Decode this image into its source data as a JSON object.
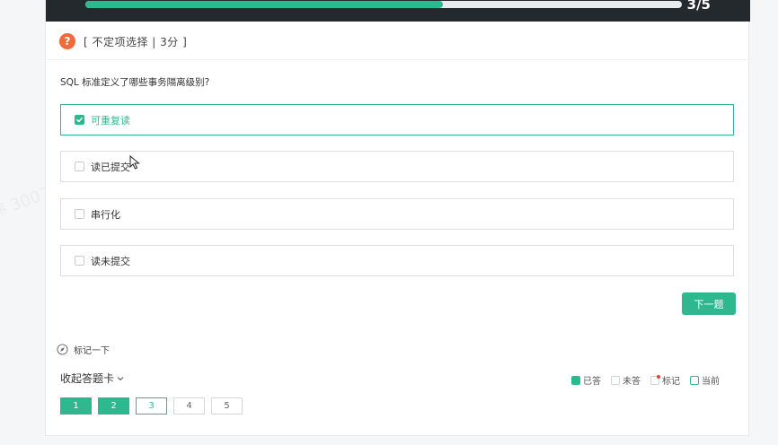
{
  "progress": {
    "text": "3/5",
    "fraction": 0.6
  },
  "question": {
    "type_label": "[ 不定项选择 | 3分 ]",
    "icon_glyph": "?",
    "text": "SQL 标准定义了哪些事务隔离级别?"
  },
  "options": [
    {
      "label": "可重复读",
      "checked": true
    },
    {
      "label": "读已提交",
      "checked": false
    },
    {
      "label": "串行化",
      "checked": false
    },
    {
      "label": "读未提交",
      "checked": false
    }
  ],
  "next_button": {
    "label": "下一题"
  },
  "mark": {
    "label": "标记一下",
    "icon": "compass-icon"
  },
  "answer_card": {
    "collapse_label": "收起答题卡",
    "legend": {
      "answered": "已答",
      "unanswered": "未答",
      "marked": "标记",
      "current": "当前"
    },
    "numbers": [
      {
        "label": "1",
        "state": "answered"
      },
      {
        "label": "2",
        "state": "answered"
      },
      {
        "label": "3",
        "state": "current"
      },
      {
        "label": "4",
        "state": "unanswered"
      },
      {
        "label": "5",
        "state": "unanswered"
      }
    ]
  },
  "watermark_text": "晓伟 3007",
  "colors": {
    "accent": "#2db88f",
    "topbar": "#24292d",
    "question_icon": "#f06a3a",
    "marked_dot": "#e0433b"
  }
}
